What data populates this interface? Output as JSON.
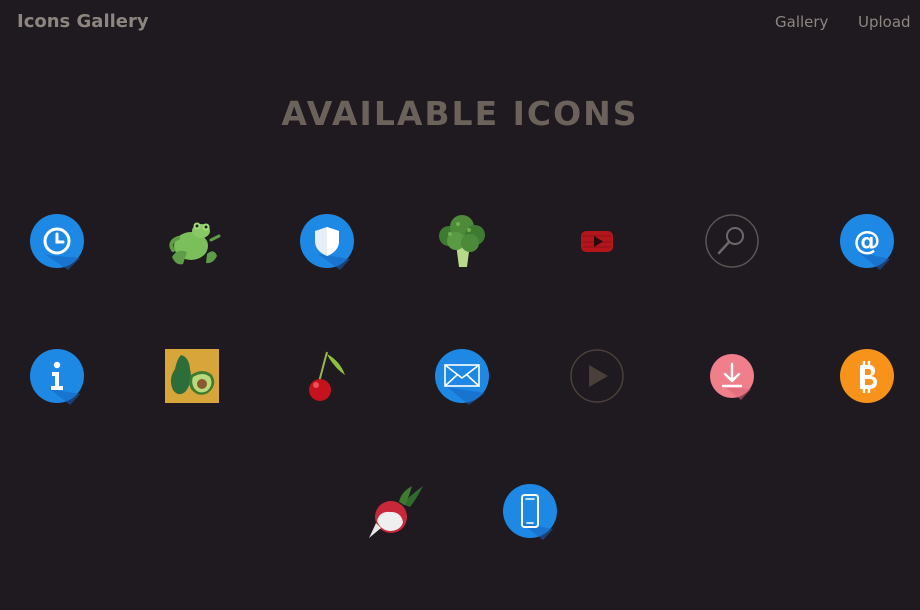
{
  "header": {
    "brand": "Icons Gallery",
    "nav": [
      {
        "label": "Gallery"
      },
      {
        "label": "Upload"
      }
    ]
  },
  "main": {
    "title": "AVAILABLE ICONS"
  },
  "colors": {
    "background": "#1f1a1f",
    "header_text": "#8d8680",
    "title_text": "#6b625b",
    "blue_icon": "#1e88e5"
  },
  "icons": [
    {
      "name": "clock-icon"
    },
    {
      "name": "frog-icon"
    },
    {
      "name": "shield-icon"
    },
    {
      "name": "broccoli-icon"
    },
    {
      "name": "youtube-icon"
    },
    {
      "name": "search-icon"
    },
    {
      "name": "at-sign-icon"
    },
    {
      "name": "info-icon"
    },
    {
      "name": "avocado-icon"
    },
    {
      "name": "cherry-icon"
    },
    {
      "name": "mail-icon"
    },
    {
      "name": "play-icon"
    },
    {
      "name": "download-icon"
    },
    {
      "name": "bitcoin-icon"
    },
    {
      "name": "radish-icon"
    },
    {
      "name": "smartphone-icon"
    }
  ]
}
